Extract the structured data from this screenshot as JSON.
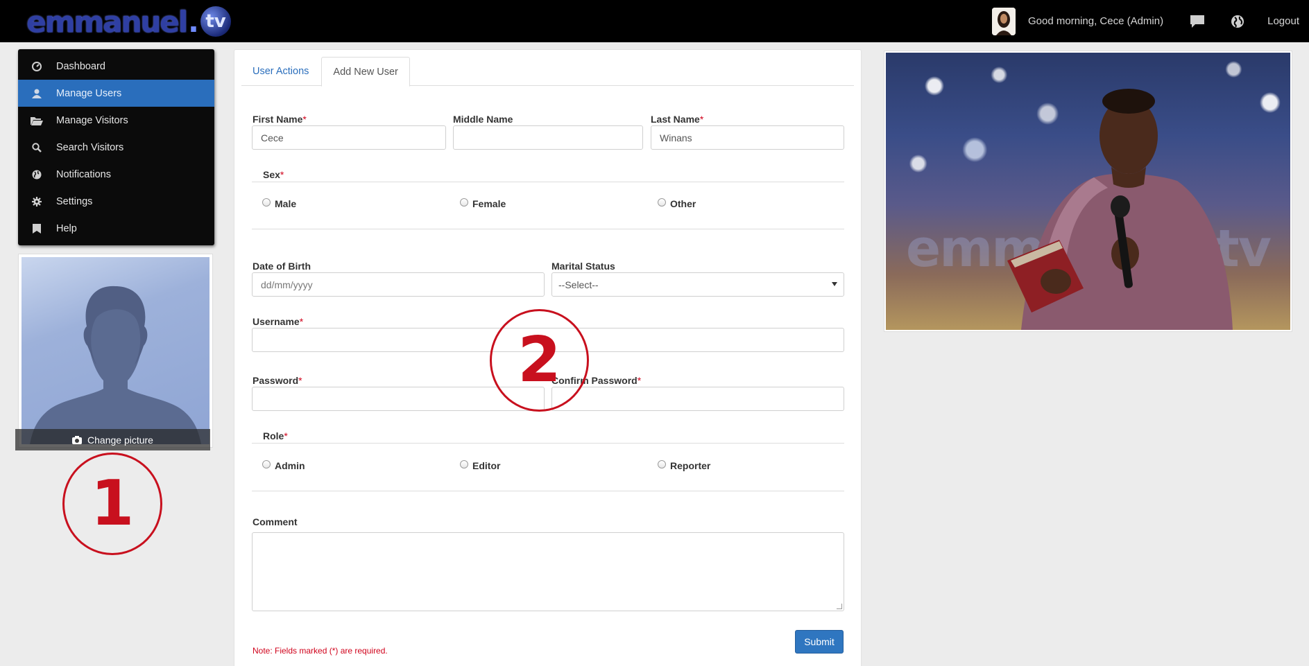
{
  "header": {
    "logo_word": "emmanuel",
    "logo_dot": ".",
    "logo_tv": "tv",
    "greeting": "Good morning, Cece (Admin)",
    "logout_label": "Logout",
    "icons": [
      "chat-icon",
      "globe-icon"
    ]
  },
  "sidebar": {
    "items": [
      {
        "label": "Dashboard",
        "icon": "dashboard-icon",
        "active": false
      },
      {
        "label": "Manage Users",
        "icon": "user-icon",
        "active": true
      },
      {
        "label": "Manage Visitors",
        "icon": "folder-icon",
        "active": false
      },
      {
        "label": "Search Visitors",
        "icon": "search-icon",
        "active": false
      },
      {
        "label": "Notifications",
        "icon": "globe-icon",
        "active": false
      },
      {
        "label": "Settings",
        "icon": "gear-icon",
        "active": false
      },
      {
        "label": "Help",
        "icon": "bookmark-icon",
        "active": false
      }
    ]
  },
  "profile": {
    "change_picture_label": "Change picture"
  },
  "annotations": [
    "1",
    "2"
  ],
  "tabs": [
    "User Actions",
    "Add New User"
  ],
  "form": {
    "first_name": {
      "label": "First Name",
      "value": "Cece"
    },
    "middle_name": {
      "label": "Middle Name",
      "value": ""
    },
    "last_name": {
      "label": "Last Name",
      "value": "Winans"
    },
    "sex": {
      "label": "Sex",
      "options": [
        "Male",
        "Female",
        "Other"
      ]
    },
    "dob": {
      "label": "Date of Birth",
      "placeholder": "dd/mm/yyyy"
    },
    "marital": {
      "label": "Marital Status",
      "selected": "--Select--"
    },
    "username": {
      "label": "Username",
      "value": ""
    },
    "password": {
      "label": "Password",
      "value": ""
    },
    "confirm_password": {
      "label": "Confirm Password",
      "value": ""
    },
    "role": {
      "label": "Role",
      "options": [
        "Admin",
        "Editor",
        "Reporter"
      ]
    },
    "comment": {
      "label": "Comment",
      "value": ""
    },
    "required_mark": "*",
    "submit_label": "Submit",
    "note": "Note: Fields marked (*) are required."
  },
  "hero": {
    "watermark": "emmanuel.tv"
  },
  "colors": {
    "accent": "#2a6ebc",
    "required": "#d0021b",
    "annotation": "#c8101e"
  }
}
